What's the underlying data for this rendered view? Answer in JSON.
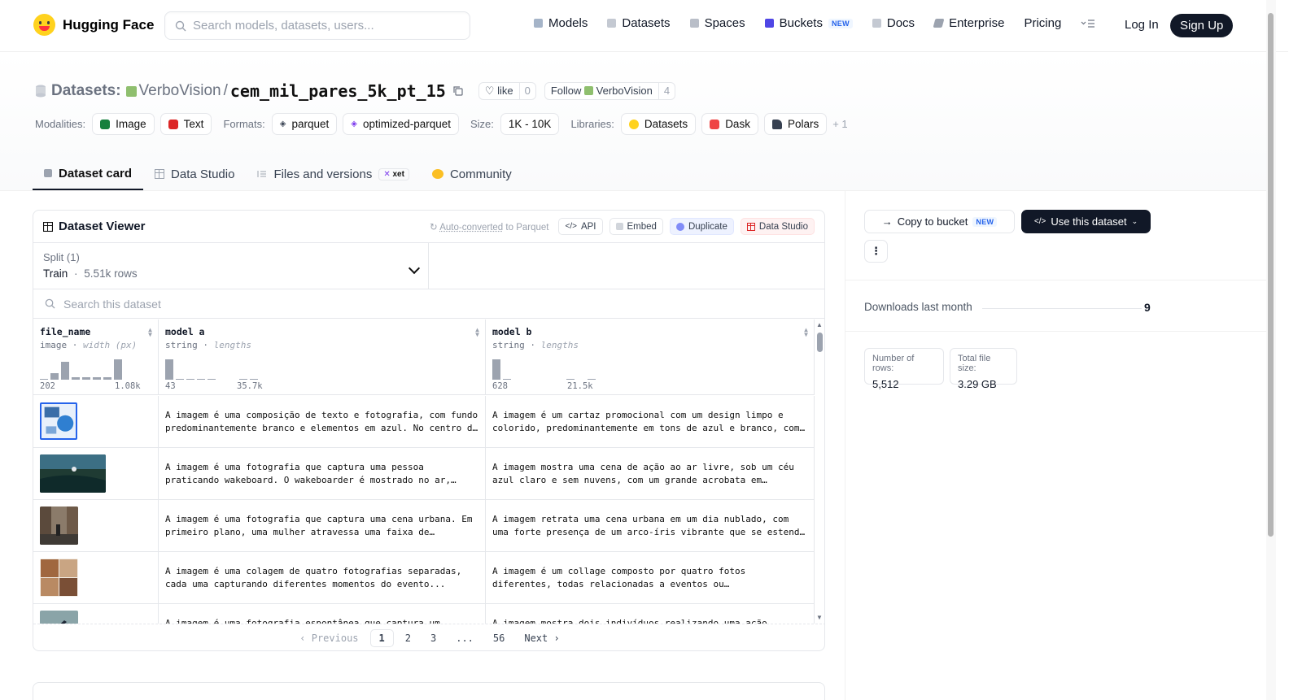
{
  "nav": {
    "brand": "Hugging Face",
    "search_placeholder": "Search models, datasets, users...",
    "links": [
      "Models",
      "Datasets",
      "Spaces",
      "Buckets",
      "Docs",
      "Enterprise",
      "Pricing"
    ],
    "new_badge": "NEW",
    "login": "Log In",
    "signup": "Sign Up"
  },
  "header": {
    "prefix": "Datasets:",
    "owner": "VerboVision",
    "sep": "/",
    "repo": "cem_mil_pares_5k_pt_15",
    "like_label": "like",
    "like_count": "0",
    "follow_label": "Follow",
    "follow_org": "VerboVision",
    "follow_count": "4",
    "modalities_label": "Modalities:",
    "modalities": [
      "Image",
      "Text"
    ],
    "formats_label": "Formats:",
    "formats": [
      "parquet",
      "optimized-parquet"
    ],
    "size_label": "Size:",
    "size": "1K - 10K",
    "libraries_label": "Libraries:",
    "libraries": [
      "Datasets",
      "Dask",
      "Polars"
    ],
    "more_libs": "+ 1"
  },
  "tabs": [
    "Dataset card",
    "Data Studio",
    "Files and versions",
    "Community"
  ],
  "xet_badge": "xet",
  "viewer": {
    "title": "Dataset Viewer",
    "auto_converted": "Auto-converted",
    "to_parquet": "to Parquet",
    "api": "API",
    "embed": "Embed",
    "duplicate": "Duplicate",
    "data_studio": "Data Studio",
    "split_label": "Split (1)",
    "split_name": "Train",
    "split_dot": "·",
    "split_rows": "5.51k rows",
    "search_placeholder": "Search this dataset",
    "columns": [
      {
        "name": "file_name",
        "type": "image",
        "dot": "·",
        "stat": "width (px)",
        "min": "202",
        "max": "1.08k",
        "hist": [
          0.05,
          0.3,
          0.8,
          0.1,
          0.1,
          0.1,
          0.1,
          0.9
        ]
      },
      {
        "name": "model a",
        "type": "string",
        "dot": "·",
        "stat": "lengths",
        "min": "43",
        "max": "35.7k",
        "hist": [
          0.9,
          0.05,
          0.05,
          0.05,
          0.05,
          0,
          0,
          0.05,
          0.05
        ]
      },
      {
        "name": "model b",
        "type": "string",
        "dot": "·",
        "stat": "lengths",
        "min": "628",
        "max": "21.5k",
        "hist": [
          0.9,
          0.05,
          0,
          0,
          0,
          0,
          0,
          0.05,
          0,
          0.05
        ]
      }
    ],
    "rows": [
      {
        "a": "A imagem é uma composição de texto e fotografia, com fundo predominantemente branco e elementos em azul. No centro da imagem...",
        "b": "A imagem é um cartaz promocional com um design limpo e colorido, predominantemente em tons de azul e branco, com elementos gráficos..."
      },
      {
        "a": "A imagem é uma fotografia que captura uma pessoa praticando wakeboard. O wakeboarder é mostrado no ar, realizando uma manobra...",
        "b": "A imagem mostra uma cena de ação ao ar livre, sob um céu azul claro e sem nuvens, com um grande acrobata em destaque..."
      },
      {
        "a": "A imagem é uma fotografia que captura uma cena urbana. Em primeiro plano, uma mulher atravessa uma faixa de pedestres...",
        "b": "A imagem retrata uma cena urbana em um dia nublado, com uma forte presença de um arco-íris vibrante que se estende pelo céu..."
      },
      {
        "a": "A imagem é uma colagem de quatro fotografias separadas, cada uma capturando diferentes momentos do evento...",
        "b": "A imagem é um collage composto por quatro fotos diferentes, todas relacionadas a eventos ou…"
      },
      {
        "a": "A imagem é uma fotografia espontânea que captura um momento...",
        "b": "A imagem mostra dois indivíduos realizando uma ação..."
      }
    ],
    "pager": {
      "prev": "Previous",
      "pages": [
        "1",
        "2",
        "3",
        "...",
        "56"
      ],
      "next": "Next"
    }
  },
  "sidebar": {
    "copy_bucket": "Copy to bucket",
    "use_dataset": "Use this dataset",
    "more": "⋮",
    "downloads_label": "Downloads last month",
    "downloads_value": "9",
    "rows_label": "Number of rows:",
    "rows_value": "5,512",
    "size_label": "Total file size:",
    "size_value": "3.29 GB"
  }
}
